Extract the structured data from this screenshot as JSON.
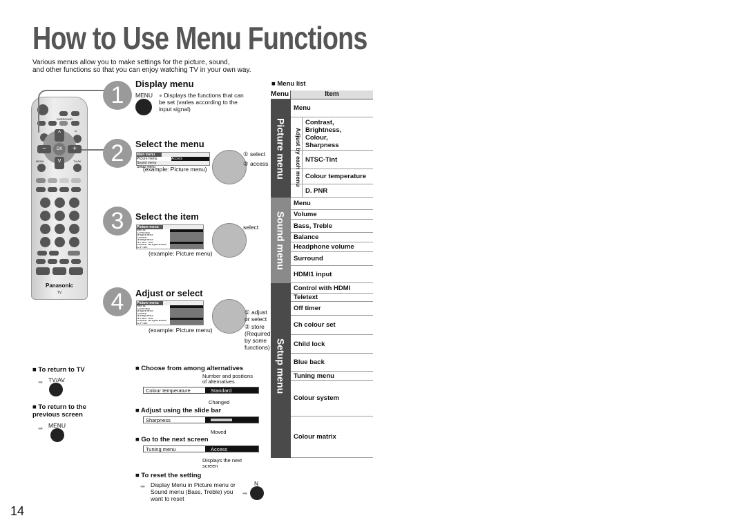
{
  "title": "How to Use Menu Functions",
  "intro": [
    "Various menus allow you to make settings for the picture, sound,",
    "and other functions so that you can enjoy watching TV in your own way."
  ],
  "remote": {
    "brand": "Panasonic",
    "model": "TV",
    "surround": "SURROUND",
    "n": "N",
    "menu": "MENU",
    "tvav": "TV/AV",
    "ok": "OK"
  },
  "steps": [
    {
      "num": "1",
      "heading": "Display menu",
      "button": "MENU",
      "note": "Displays the functions that can be set (varies according to the input signal)"
    },
    {
      "num": "2",
      "heading": "Select the menu",
      "example": "(example: Picture menu)",
      "labels": [
        "① select",
        "② access"
      ],
      "screen_title": "Main menu",
      "screen_items": [
        "Picture menu",
        "Sound menu",
        "Setup menu"
      ],
      "screen_value": "Access"
    },
    {
      "num": "3",
      "heading": "Select the item",
      "example": "(example: Picture menu)",
      "labels": [
        "select"
      ],
      "screen_title": "Picture menu"
    },
    {
      "num": "4",
      "heading": "Adjust or select",
      "example": "(example: Picture menu)",
      "labels": [
        "① adjust or select",
        "② store (Required by some functions)"
      ],
      "screen_title": "Picture menu"
    }
  ],
  "picture_screen_items": [
    "Menu",
    "Contrast",
    "Brightness",
    "Colour",
    "Sharpness",
    "NTSC-Tint",
    "Colour temperature",
    "D.PNR"
  ],
  "return_tv": {
    "heading": "To return to TV",
    "button": "TV/AV"
  },
  "return_prev": {
    "heading": "To return to the previous screen",
    "button": "MENU"
  },
  "choose": {
    "heading": "Choose from among alternatives",
    "label": "Colour temperature",
    "value": "Standard",
    "note_top": "Number and positions of alternatives",
    "note_bottom": "Changed"
  },
  "slide": {
    "heading": "Adjust using the slide bar",
    "label": "Sharpness",
    "note": "Moved"
  },
  "next": {
    "heading": "Go to the next screen",
    "label": "Tuning menu",
    "value": "Access",
    "note": "Displays the next screen"
  },
  "reset": {
    "heading": "To reset the setting",
    "text": "Display Menu in Picture menu or Sound menu (Bass, Treble) you want to reset",
    "button": "N"
  },
  "menu_list": {
    "heading": "Menu list",
    "col_menu": "Menu",
    "col_item": "Item",
    "adjust_label": "Adjust by each menu",
    "picture": {
      "name": "Picture menu",
      "items": [
        "Menu",
        "Contrast,\nBrightness,\nColour,\nSharpness",
        "NTSC-Tint",
        "Colour temperature",
        "D. PNR"
      ]
    },
    "sound": {
      "name": "Sound menu",
      "items": [
        "Menu",
        "Volume",
        "Bass, Treble",
        "Balance",
        "Headphone volume",
        "Surround",
        "HDMI1 input"
      ]
    },
    "setup": {
      "name": "Setup menu",
      "items": [
        "Control with HDMI",
        "Teletext",
        "Off timer",
        "Ch colour set",
        "Child lock",
        "Blue back",
        "Tuning menu",
        "Colour system",
        "Colour matrix"
      ]
    }
  },
  "page_number": "14",
  "colors": {
    "dark_band": "#4a4a4a",
    "sound_band": "#8a8a8a",
    "step_circle": "#9a9a9a"
  }
}
